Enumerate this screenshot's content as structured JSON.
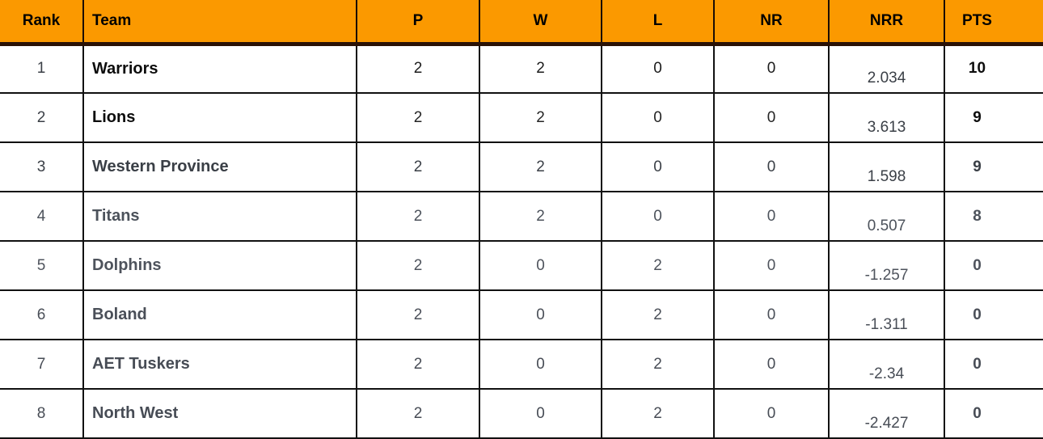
{
  "table": {
    "headers": [
      {
        "key": "rank",
        "label": "Rank"
      },
      {
        "key": "team",
        "label": "Team"
      },
      {
        "key": "p",
        "label": "P"
      },
      {
        "key": "w",
        "label": "W"
      },
      {
        "key": "l",
        "label": "L"
      },
      {
        "key": "nr",
        "label": "NR"
      },
      {
        "key": "nrr",
        "label": "NRR"
      },
      {
        "key": "pts",
        "label": "PTS"
      }
    ],
    "rows": [
      {
        "rank": "1",
        "team": "Warriors",
        "p": "2",
        "w": "2",
        "l": "0",
        "nr": "0",
        "nrr": "2.034",
        "pts": "10"
      },
      {
        "rank": "2",
        "team": "Lions",
        "p": "2",
        "w": "2",
        "l": "0",
        "nr": "0",
        "nrr": "3.613",
        "pts": "9"
      },
      {
        "rank": "3",
        "team": "Western Province",
        "p": "2",
        "w": "2",
        "l": "0",
        "nr": "0",
        "nrr": "1.598",
        "pts": "9"
      },
      {
        "rank": "4",
        "team": "Titans",
        "p": "2",
        "w": "2",
        "l": "0",
        "nr": "0",
        "nrr": "0.507",
        "pts": "8"
      },
      {
        "rank": "5",
        "team": "Dolphins",
        "p": "2",
        "w": "0",
        "l": "2",
        "nr": "0",
        "nrr": "-1.257",
        "pts": "0"
      },
      {
        "rank": "6",
        "team": "Boland",
        "p": "2",
        "w": "0",
        "l": "2",
        "nr": "0",
        "nrr": "-1.311",
        "pts": "0"
      },
      {
        "rank": "7",
        "team": "AET Tuskers",
        "p": "2",
        "w": "0",
        "l": "2",
        "nr": "0",
        "nrr": "-2.34",
        "pts": "0"
      },
      {
        "rank": "8",
        "team": "North West",
        "p": "2",
        "w": "0",
        "l": "2",
        "nr": "0",
        "nrr": "-2.427",
        "pts": "0"
      }
    ]
  },
  "colors": {
    "header_background": "#fb9900",
    "header_text": "#000000",
    "grid_line": "#111111",
    "header_rule": "#2a1206"
  }
}
